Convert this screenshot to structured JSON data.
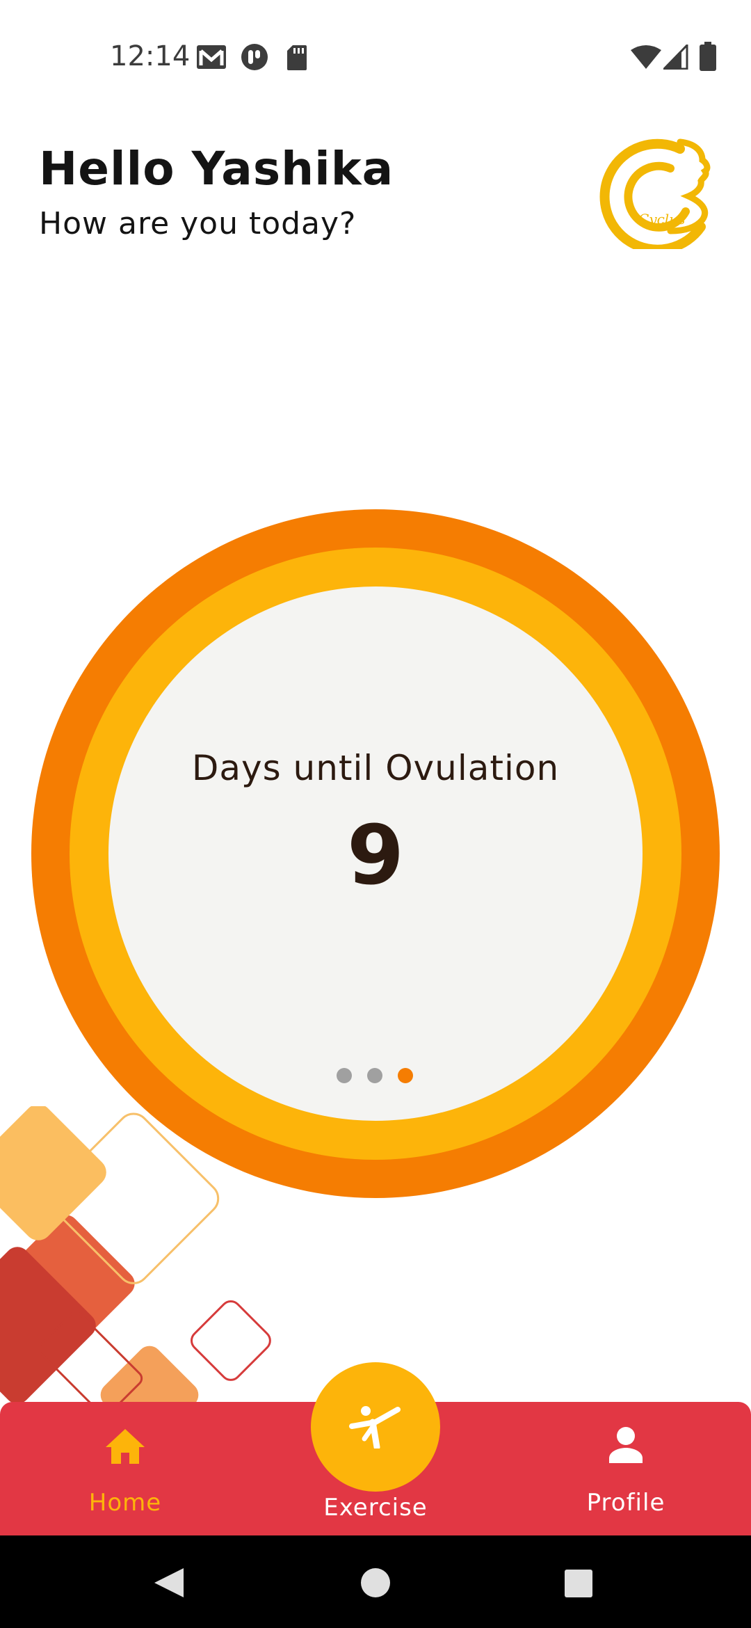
{
  "status_bar": {
    "time": "12:14",
    "left_icons": [
      "gmail-icon",
      "notification-icon",
      "sd-card-icon"
    ],
    "right_icons": [
      "wifi-icon",
      "signal-icon",
      "battery-icon"
    ]
  },
  "header": {
    "greeting": "Hello Yashika",
    "subtitle": "How are you today?",
    "logo_text": "Cyclus"
  },
  "cycle_card": {
    "label": "Days until Ovulation",
    "value": "9",
    "page_indicator": {
      "count": 3,
      "active_index": 2
    }
  },
  "bottom_nav": {
    "items": [
      {
        "label": "Home",
        "icon": "home-icon",
        "active": true
      },
      {
        "label": "Exercise",
        "icon": "exercise-icon",
        "active": false
      },
      {
        "label": "Profile",
        "icon": "person-icon",
        "active": false
      }
    ]
  },
  "system_nav": {
    "buttons": [
      "back-icon",
      "home-circle-icon",
      "recents-icon"
    ]
  },
  "colors": {
    "ring_outer": "#F57D02",
    "ring_middle": "#FDB40A",
    "ring_inner": "#F4F4F2",
    "nav_bar": "#E23744",
    "active_nav": "#FDB40A",
    "fab": "#FDB40A"
  }
}
